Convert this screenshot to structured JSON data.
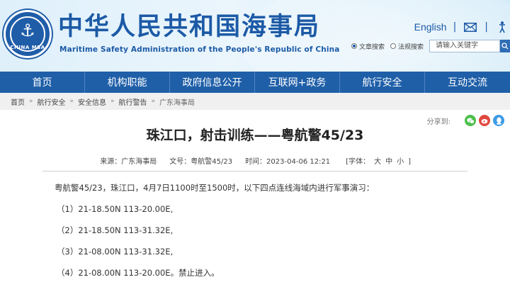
{
  "header": {
    "title_cn": "中华人民共和国海事局",
    "title_en": "Maritime Safety Administration of the People's Republic of China",
    "emblem_text": "CHINA MSA",
    "english_link": "English",
    "separator": "|",
    "icons": [
      "mail-icon",
      "accessibility-icon"
    ],
    "search": {
      "options": [
        "文章搜索",
        "法规搜索"
      ],
      "selected": "文章搜索",
      "placeholder": "请输入关键字"
    }
  },
  "nav": {
    "items": [
      "首页",
      "机构职能",
      "政府信息公开",
      "互联网+政务",
      "航行安全",
      "互动交流"
    ]
  },
  "breadcrumb": {
    "items": [
      "首页",
      "航行安全",
      "安全信息",
      "航行警告",
      "广东海事局"
    ],
    "separator": "»"
  },
  "share": {
    "label": "分享到:",
    "icons": [
      "wechat-icon",
      "weibo-icon",
      "qq-icon"
    ]
  },
  "article": {
    "title": "珠江口，射击训练——粤航警45/23",
    "meta": {
      "source": "来源：广东海事局",
      "doc_no": "文号：粤航警45/23",
      "time": "时间：2023-04-06 12:21",
      "font_label": "[字体：",
      "font_options": [
        "大",
        "中",
        "小"
      ],
      "font_close": "]"
    },
    "intro": "粤航警45/23，珠江口，4月7日1100时至1500时，以下四点连线海域内进行军事演习：",
    "coords": [
      "（1）21-18.50N 113-20.00E,",
      "（2）21-18.50N 113-31.32E,",
      "（3）21-08.00N 113-31.32E,",
      "（4）21-08.00N 113-20.00E。禁止进入。"
    ]
  },
  "colors": {
    "brand_blue": "#1c5aa6",
    "nav_blue": "#1f5fa8",
    "wechat_green": "#4cbf4b",
    "weibo_red": "#e0483f",
    "qq_blue": "#3d9be9"
  }
}
